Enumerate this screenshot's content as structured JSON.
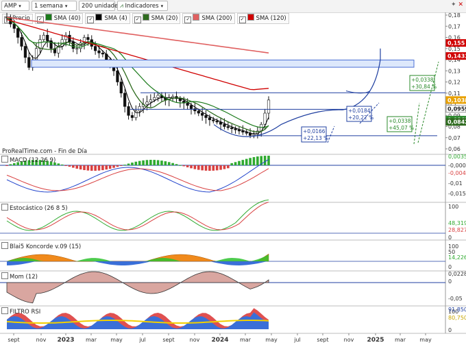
{
  "toolbar": {
    "symbol": "AMP",
    "period": "1 semana",
    "units": "200 unidades",
    "indicators_label": "Indicadores"
  },
  "legend": [
    {
      "label": "Precio",
      "color": "#ffffff"
    },
    {
      "label": "SMA (40)",
      "color": "#1a7a1a"
    },
    {
      "label": "SMA (4)",
      "color": "#000000"
    },
    {
      "label": "SMA (20)",
      "color": "#2e6b1e"
    },
    {
      "label": "SMA (200)",
      "color": "#e06060"
    },
    {
      "label": "SMA (120)",
      "color": "#d00000"
    }
  ],
  "source_text": "ProRealTime.com - Fin de Día",
  "panels": {
    "macd": "MACD (12 26 9)",
    "stoch": "Estocástico (26 8 5)",
    "blai5": "Blai5 Koncorde v.09 (15)",
    "mom": "Mom (12)",
    "rsi": "FILTRO RSI"
  },
  "x_axis_labels": [
    "sept",
    "nov",
    "2023",
    "mar",
    "may",
    "jul",
    "sept",
    "nov",
    "2024",
    "mar",
    "may",
    "jul",
    "sept",
    "nov",
    "2025",
    "mar",
    "may"
  ],
  "chart_data": {
    "type": "line",
    "price_axis_ticks": [
      "0,18",
      "0,17",
      "0,16",
      "0,15",
      "0,14",
      "0,13",
      "0,12",
      "0,11",
      "0,1",
      "0,09",
      "0,08",
      "0,07",
      "0,06"
    ],
    "price_badges": [
      {
        "label": "0,155",
        "color": "#d00000"
      },
      {
        "label": "0,1433",
        "color": "#d00000"
      },
      {
        "label": "0,1038",
        "color": "#e8a000"
      },
      {
        "label": "0,0959",
        "color": "#222222"
      },
      {
        "label": "0,0862",
        "color": "#2e8b2e"
      },
      {
        "label": "0,0842",
        "color": "#2e6b1e"
      }
    ],
    "annotations": [
      {
        "text1": "+0,0338",
        "text2": "+30,84 %",
        "color": "#2a8a2a"
      },
      {
        "text1": "+0,0184",
        "text2": "+20,22 %",
        "color": "#1f3fa0"
      },
      {
        "text1": "+0,0338",
        "text2": "+45,07 %",
        "color": "#2a8a2a"
      },
      {
        "text1": "+0,0166",
        "text2": "+22,13 %",
        "color": "#1f3fa0"
      }
    ],
    "macd_axis_ticks": [
      "0,0035",
      "-0,0009",
      "-0,0044",
      "-0,01",
      "-0,015"
    ],
    "stoch_axis_ticks": [
      "100",
      "48,319",
      "28,827",
      "0"
    ],
    "blai5_axis_ticks": [
      "100",
      "50",
      "14,226",
      "0"
    ],
    "mom_axis_ticks": [
      "0,0228",
      "0",
      "-0,05"
    ],
    "rsi_axis_ticks": [
      "100",
      "91,850",
      "80,750",
      "0"
    ],
    "price_series": [
      0.178,
      0.172,
      0.168,
      0.16,
      0.152,
      0.142,
      0.133,
      0.14,
      0.15,
      0.158,
      0.162,
      0.157,
      0.15,
      0.146,
      0.152,
      0.158,
      0.162,
      0.156,
      0.15,
      0.15,
      0.155,
      0.16,
      0.158,
      0.152,
      0.148,
      0.146,
      0.145,
      0.14,
      0.136,
      0.13,
      0.12,
      0.11,
      0.098,
      0.09,
      0.088,
      0.094,
      0.098,
      0.1,
      0.102,
      0.104,
      0.106,
      0.108,
      0.106,
      0.104,
      0.106,
      0.107,
      0.105,
      0.103,
      0.101,
      0.099,
      0.096,
      0.094,
      0.092,
      0.09,
      0.088,
      0.086,
      0.085,
      0.084,
      0.082,
      0.08,
      0.079,
      0.078,
      0.077,
      0.076,
      0.075,
      0.074,
      0.072,
      0.073,
      0.076,
      0.082,
      0.092,
      0.1038
    ]
  }
}
